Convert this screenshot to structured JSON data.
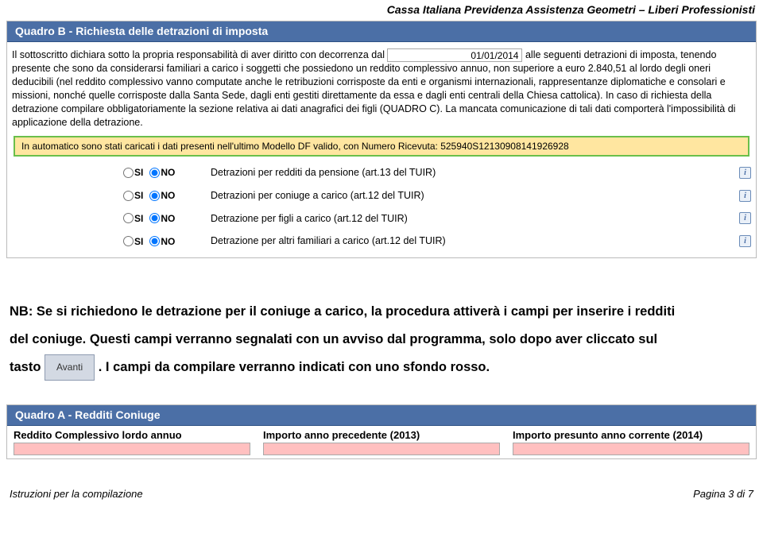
{
  "header": {
    "org": "Cassa Italiana Previdenza Assistenza Geometri – Liberi Professionisti"
  },
  "quadroB": {
    "title": "Quadro B - Richiesta delle detrazioni di imposta",
    "decl_pre": "Il sottoscritto dichiara sotto la propria responsabilità di aver diritto con decorrenza dal",
    "date_value": "01/01/2014",
    "decl_post": " alle seguenti detrazioni di imposta, tenendo presente che sono da considerarsi familiari a carico i soggetti che possiedono un reddito complessivo annuo, non superiore a euro 2.840,51 al lordo degli oneri deducibili (nel reddito complessivo vanno computate anche le retribuzioni corrisposte da enti e organismi internazionali, rappresentanze diplomatiche e consolari e missioni, nonché quelle corrisposte dalla Santa Sede, dagli enti gestiti direttamente da essa e dagli enti centrali della Chiesa cattolica). In caso di richiesta della detrazione compilare obbligatoriamente la sezione relativa ai dati anagrafici dei figli (QUADRO C). La mancata comunicazione di tali dati comporterà l'impossibilità di applicazione della detrazione.",
    "info_strip": "In automatico sono stati caricati i dati presenti nell'ultimo Modello DF valido, con Numero Ricevuta: 525940S12130908141926928",
    "si": "SI",
    "no": "NO",
    "rows": [
      {
        "label": "Detrazioni per redditi da pensione (art.13 del TUIR)"
      },
      {
        "label": "Detrazioni per coniuge a carico (art.12 del TUIR)"
      },
      {
        "label": "Detrazione per figli a carico (art.12 del TUIR)"
      },
      {
        "label": "Detrazione per altri familiari a carico (art.12 del TUIR)"
      }
    ]
  },
  "nb": {
    "line1": "NB: Se si richiedono le detrazione per il coniuge a carico, la procedura attiverà i campi per inserire i redditi",
    "line2_pre": "del coniuge. Questi campi verranno segnalati con un avviso dal programma, solo dopo aver cliccato sul",
    "line3_pre": "tasto ",
    "avanti": "Avanti",
    "line3_post": ". I campi da compilare verranno indicati con uno sfondo rosso."
  },
  "quadroA": {
    "title": "Quadro A - Redditi Coniuge",
    "col1": "Reddito Complessivo lordo annuo",
    "col2": "Importo anno precedente (2013)",
    "col3": "Importo presunto anno corrente (2014)"
  },
  "footer": {
    "left": "Istruzioni per la compilazione",
    "right": "Pagina 3 di 7"
  }
}
